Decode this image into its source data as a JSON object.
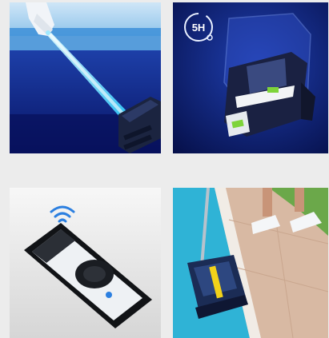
{
  "tiles": [
    {
      "id": "remote-beam"
    },
    {
      "id": "battery-5h",
      "badge_text": "5H"
    },
    {
      "id": "smartphone-app"
    },
    {
      "id": "poolside-lift"
    }
  ],
  "colors": {
    "page_bg": "#ececec",
    "water_deep": "#0b1a6e",
    "beam": "#5fe6ff",
    "robot_dark": "#1b2440",
    "robot_accent": "#f2d21a",
    "battery_green": "#7ed43a"
  }
}
